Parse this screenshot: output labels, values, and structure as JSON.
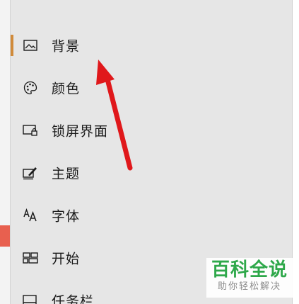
{
  "nav": {
    "items": [
      {
        "label": "背景",
        "icon": "picture-icon",
        "selected": true
      },
      {
        "label": "颜色",
        "icon": "palette-icon",
        "selected": false
      },
      {
        "label": "锁屏界面",
        "icon": "lock-screen-icon",
        "selected": false
      },
      {
        "label": "主题",
        "icon": "theme-brush-icon",
        "selected": false
      },
      {
        "label": "字体",
        "icon": "font-icon",
        "selected": false
      },
      {
        "label": "开始",
        "icon": "start-tiles-icon",
        "selected": false
      },
      {
        "label": "任务栏",
        "icon": "taskbar-icon",
        "selected": false
      }
    ]
  },
  "annotation": {
    "arrow_color": "#e0181b",
    "points_to": "背景"
  },
  "watermark": {
    "main": "百科全说",
    "sub": "助你轻松解决"
  },
  "colors": {
    "panel_bg": "#e6e6e6",
    "selected_indicator": "#d08a3a",
    "watermark_green": "#2ea84a"
  }
}
